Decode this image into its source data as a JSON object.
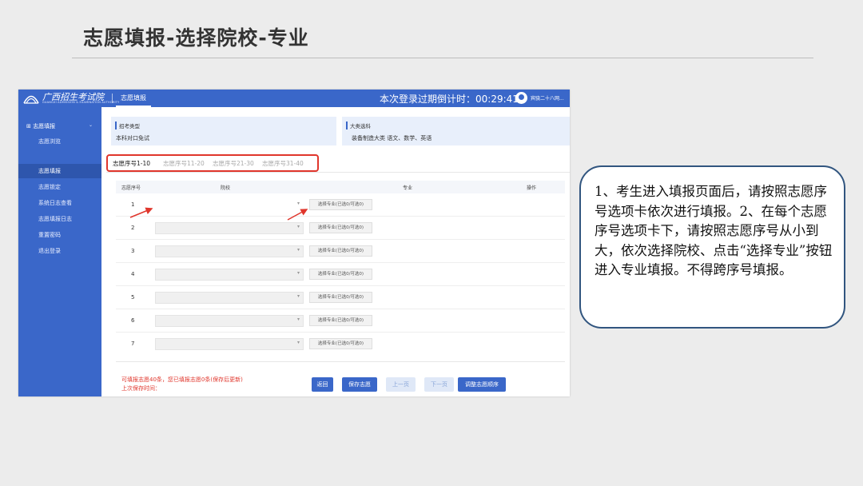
{
  "slide": {
    "title": "志愿填报-选择院校-专业"
  },
  "app": {
    "logo_text": "广西招生考试院",
    "logo_sub": "GUANGXI ADMISSION & EXAMINATION AUTHORITY",
    "header_tab": "志愿填报",
    "countdown": "本次登录过期倒计时：00:29:41",
    "user_name": "宾骁二十八网...",
    "sidebar": {
      "group": "志愿填报",
      "items": [
        {
          "label": "志愿浏览"
        },
        {
          "label": "志愿填报"
        },
        {
          "label": "志愿锁定"
        },
        {
          "label": "系统日志查看"
        },
        {
          "label": "志愿填报日志"
        },
        {
          "label": "重置密码"
        },
        {
          "label": "退出登录"
        }
      ]
    },
    "info": {
      "exam_type_label": "招考类型",
      "exam_type_value": "本科对口免试",
      "category_label": "大类选科",
      "category_value": "装备制造大类  语文、数学、英语"
    },
    "tabs": [
      {
        "label": "志愿序号1-10"
      },
      {
        "label": "志愿序号11-20"
      },
      {
        "label": "志愿序号21-30"
      },
      {
        "label": "志愿序号31-40"
      }
    ],
    "table": {
      "headers": [
        "志愿序号",
        "院校",
        "专业",
        "操作"
      ],
      "rows": [
        {
          "num": "1",
          "button": "选择专业(已选0/可选0)"
        },
        {
          "num": "2",
          "button": "选择专业(已选0/可选0)"
        },
        {
          "num": "3",
          "button": "选择专业(已选0/可选0)"
        },
        {
          "num": "4",
          "button": "选择专业(已选0/可选0)"
        },
        {
          "num": "5",
          "button": "选择专业(已选0/可选0)"
        },
        {
          "num": "6",
          "button": "选择专业(已选0/可选0)"
        },
        {
          "num": "7",
          "button": "选择专业(已选0/可选0)"
        }
      ]
    },
    "footer": {
      "note_line1": "可填报志愿40条，您已填报志愿0条(保存后更新)",
      "note_line2": "上次保存时间：",
      "btn_back": "返回",
      "btn_save": "保存志愿",
      "btn_prev": "上一页",
      "btn_next": "下一页",
      "btn_reorder": "调整志愿顺序"
    }
  },
  "callout": {
    "text": "1、考生进入填报页面后，请按照志愿序号选项卡依次进行填报。2、在每个志愿序号选项卡下，请按照志愿序号从小到大，依次选择院校、点击“选择专业”按钮进入专业填报。不得跨序号填报。"
  },
  "colors": {
    "primary": "#3a67c9",
    "highlight": "#e0362c",
    "callout_border": "#31557f"
  }
}
